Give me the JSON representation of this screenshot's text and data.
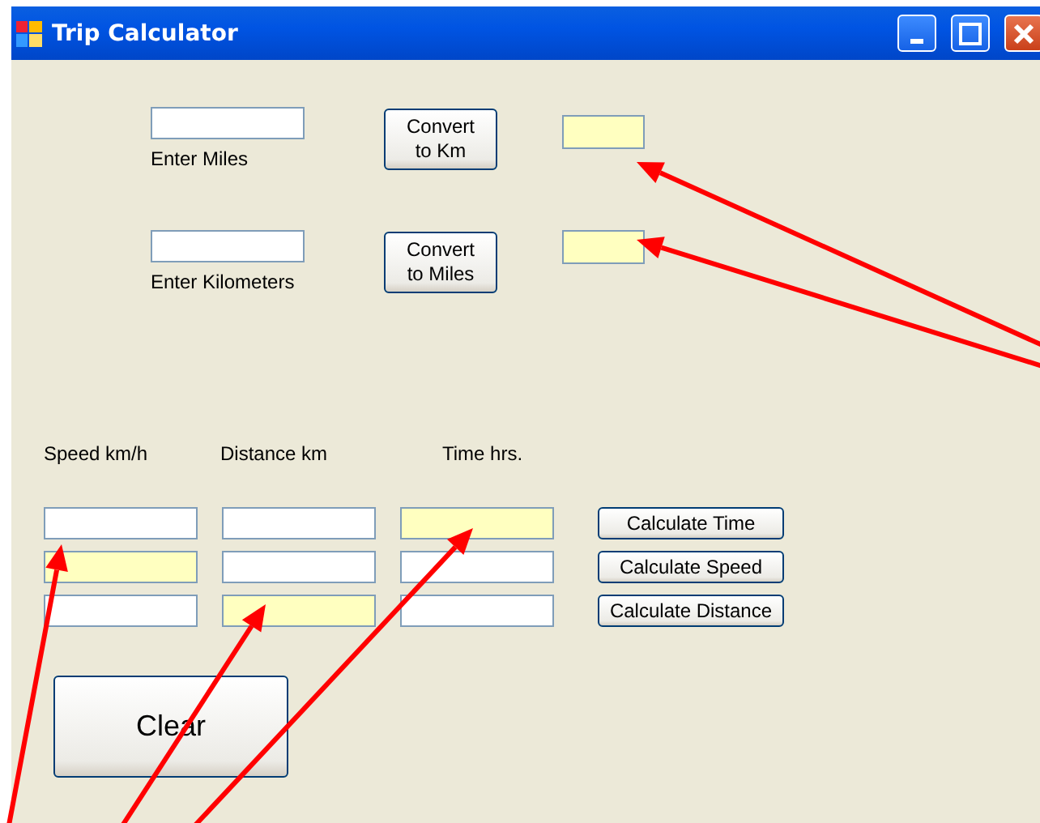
{
  "window": {
    "title": "Trip Calculator"
  },
  "converters": [
    {
      "label": "Enter Miles",
      "button": "Convert to Km"
    },
    {
      "label": "Enter Kilometers",
      "button": "Convert to Miles"
    }
  ],
  "grid": {
    "columns": [
      "Speed km/h",
      "Distance km",
      "Time hrs."
    ],
    "rows": [
      {
        "cells": [
          {
            "highlighted": false
          },
          {
            "highlighted": false
          },
          {
            "highlighted": true
          }
        ],
        "button": "Calculate Time"
      },
      {
        "cells": [
          {
            "highlighted": true
          },
          {
            "highlighted": false
          },
          {
            "highlighted": false
          }
        ],
        "button": "Calculate Speed"
      },
      {
        "cells": [
          {
            "highlighted": false
          },
          {
            "highlighted": true
          },
          {
            "highlighted": false
          }
        ],
        "button": "Calculate Distance"
      }
    ]
  },
  "clear_button": "Clear"
}
